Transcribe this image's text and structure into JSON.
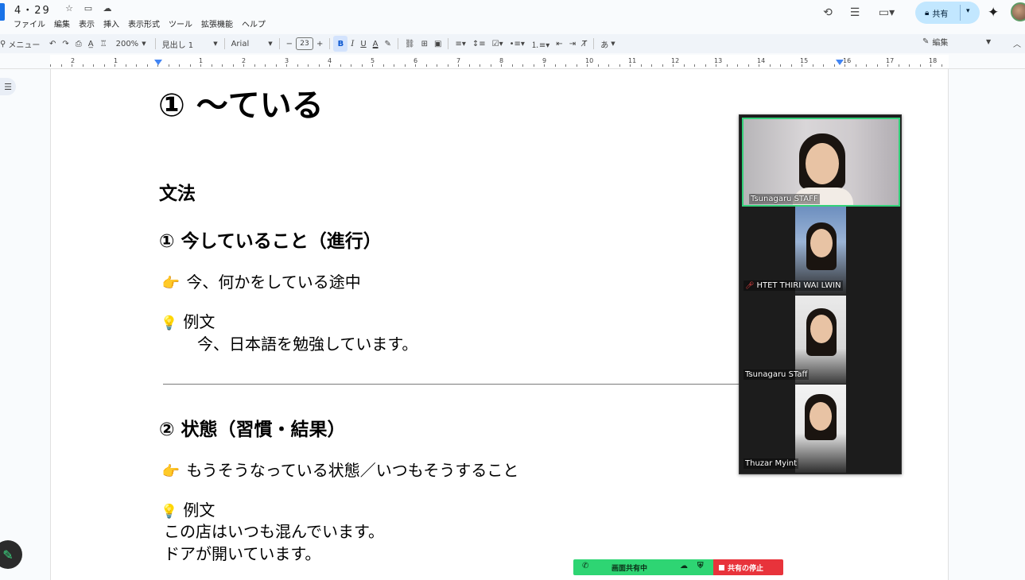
{
  "title_bar": {
    "doc_title": "4・29",
    "icons": [
      "star-icon",
      "folder-move-icon",
      "cloud-status-icon"
    ],
    "menu": [
      "ファイル",
      "編集",
      "表示",
      "挿入",
      "表示形式",
      "ツール",
      "拡張機能",
      "ヘルプ"
    ],
    "right_icons": [
      "history-icon",
      "comment-icon",
      "video-call-icon"
    ],
    "share_label": "共有"
  },
  "toolbar": {
    "search_label": "メニュー",
    "zoom": "200%",
    "style": "見出し 1",
    "font": "Arial",
    "font_size": "23",
    "minus": "−",
    "plus": "+",
    "bold": "B",
    "italic": "I",
    "underline": "U",
    "text_color": "A",
    "input_tools": "あ",
    "edit_mode": "編集"
  },
  "ruler": {
    "numbers": [
      "2",
      "1",
      "1",
      "2",
      "3",
      "4",
      "5",
      "6",
      "7",
      "8",
      "9",
      "10",
      "11",
      "12",
      "13",
      "14",
      "15",
      "16",
      "17",
      "18"
    ]
  },
  "document": {
    "h1": "① 〜ている",
    "h2_grammar": "文法",
    "h2_section1": "① 今していること（進行）",
    "point_emoji": "👉",
    "bulb_emoji": "💡",
    "line1": "今、何かをしている途中",
    "example_label": "例文",
    "example1": "今、日本語を勉強しています。",
    "h2_section2": "② 状態（習慣・結果）",
    "line2": "もうそうなっている状態／いつもそうすること",
    "example_label2": "例文",
    "example2a": "この店はいつも混んでいます。",
    "example2b": "ドアが開いています。"
  },
  "video_panel": {
    "participants": [
      {
        "name": "Tsunagaru STAFF",
        "muted": false,
        "active": true
      },
      {
        "name": "HTET THIRI WAI LWIN",
        "muted": true,
        "active": false
      },
      {
        "name": "Tsunagaru STaff",
        "muted": false,
        "active": false
      },
      {
        "name": "Thuzar Myint",
        "muted": false,
        "active": false
      }
    ]
  },
  "share_bar": {
    "status": "画面共有中",
    "stop": "共有の停止"
  },
  "colors": {
    "share_green": "#2ed573",
    "stop_red": "#e8333b",
    "active_speaker": "#33d17a",
    "share_button": "#c2e7ff"
  }
}
